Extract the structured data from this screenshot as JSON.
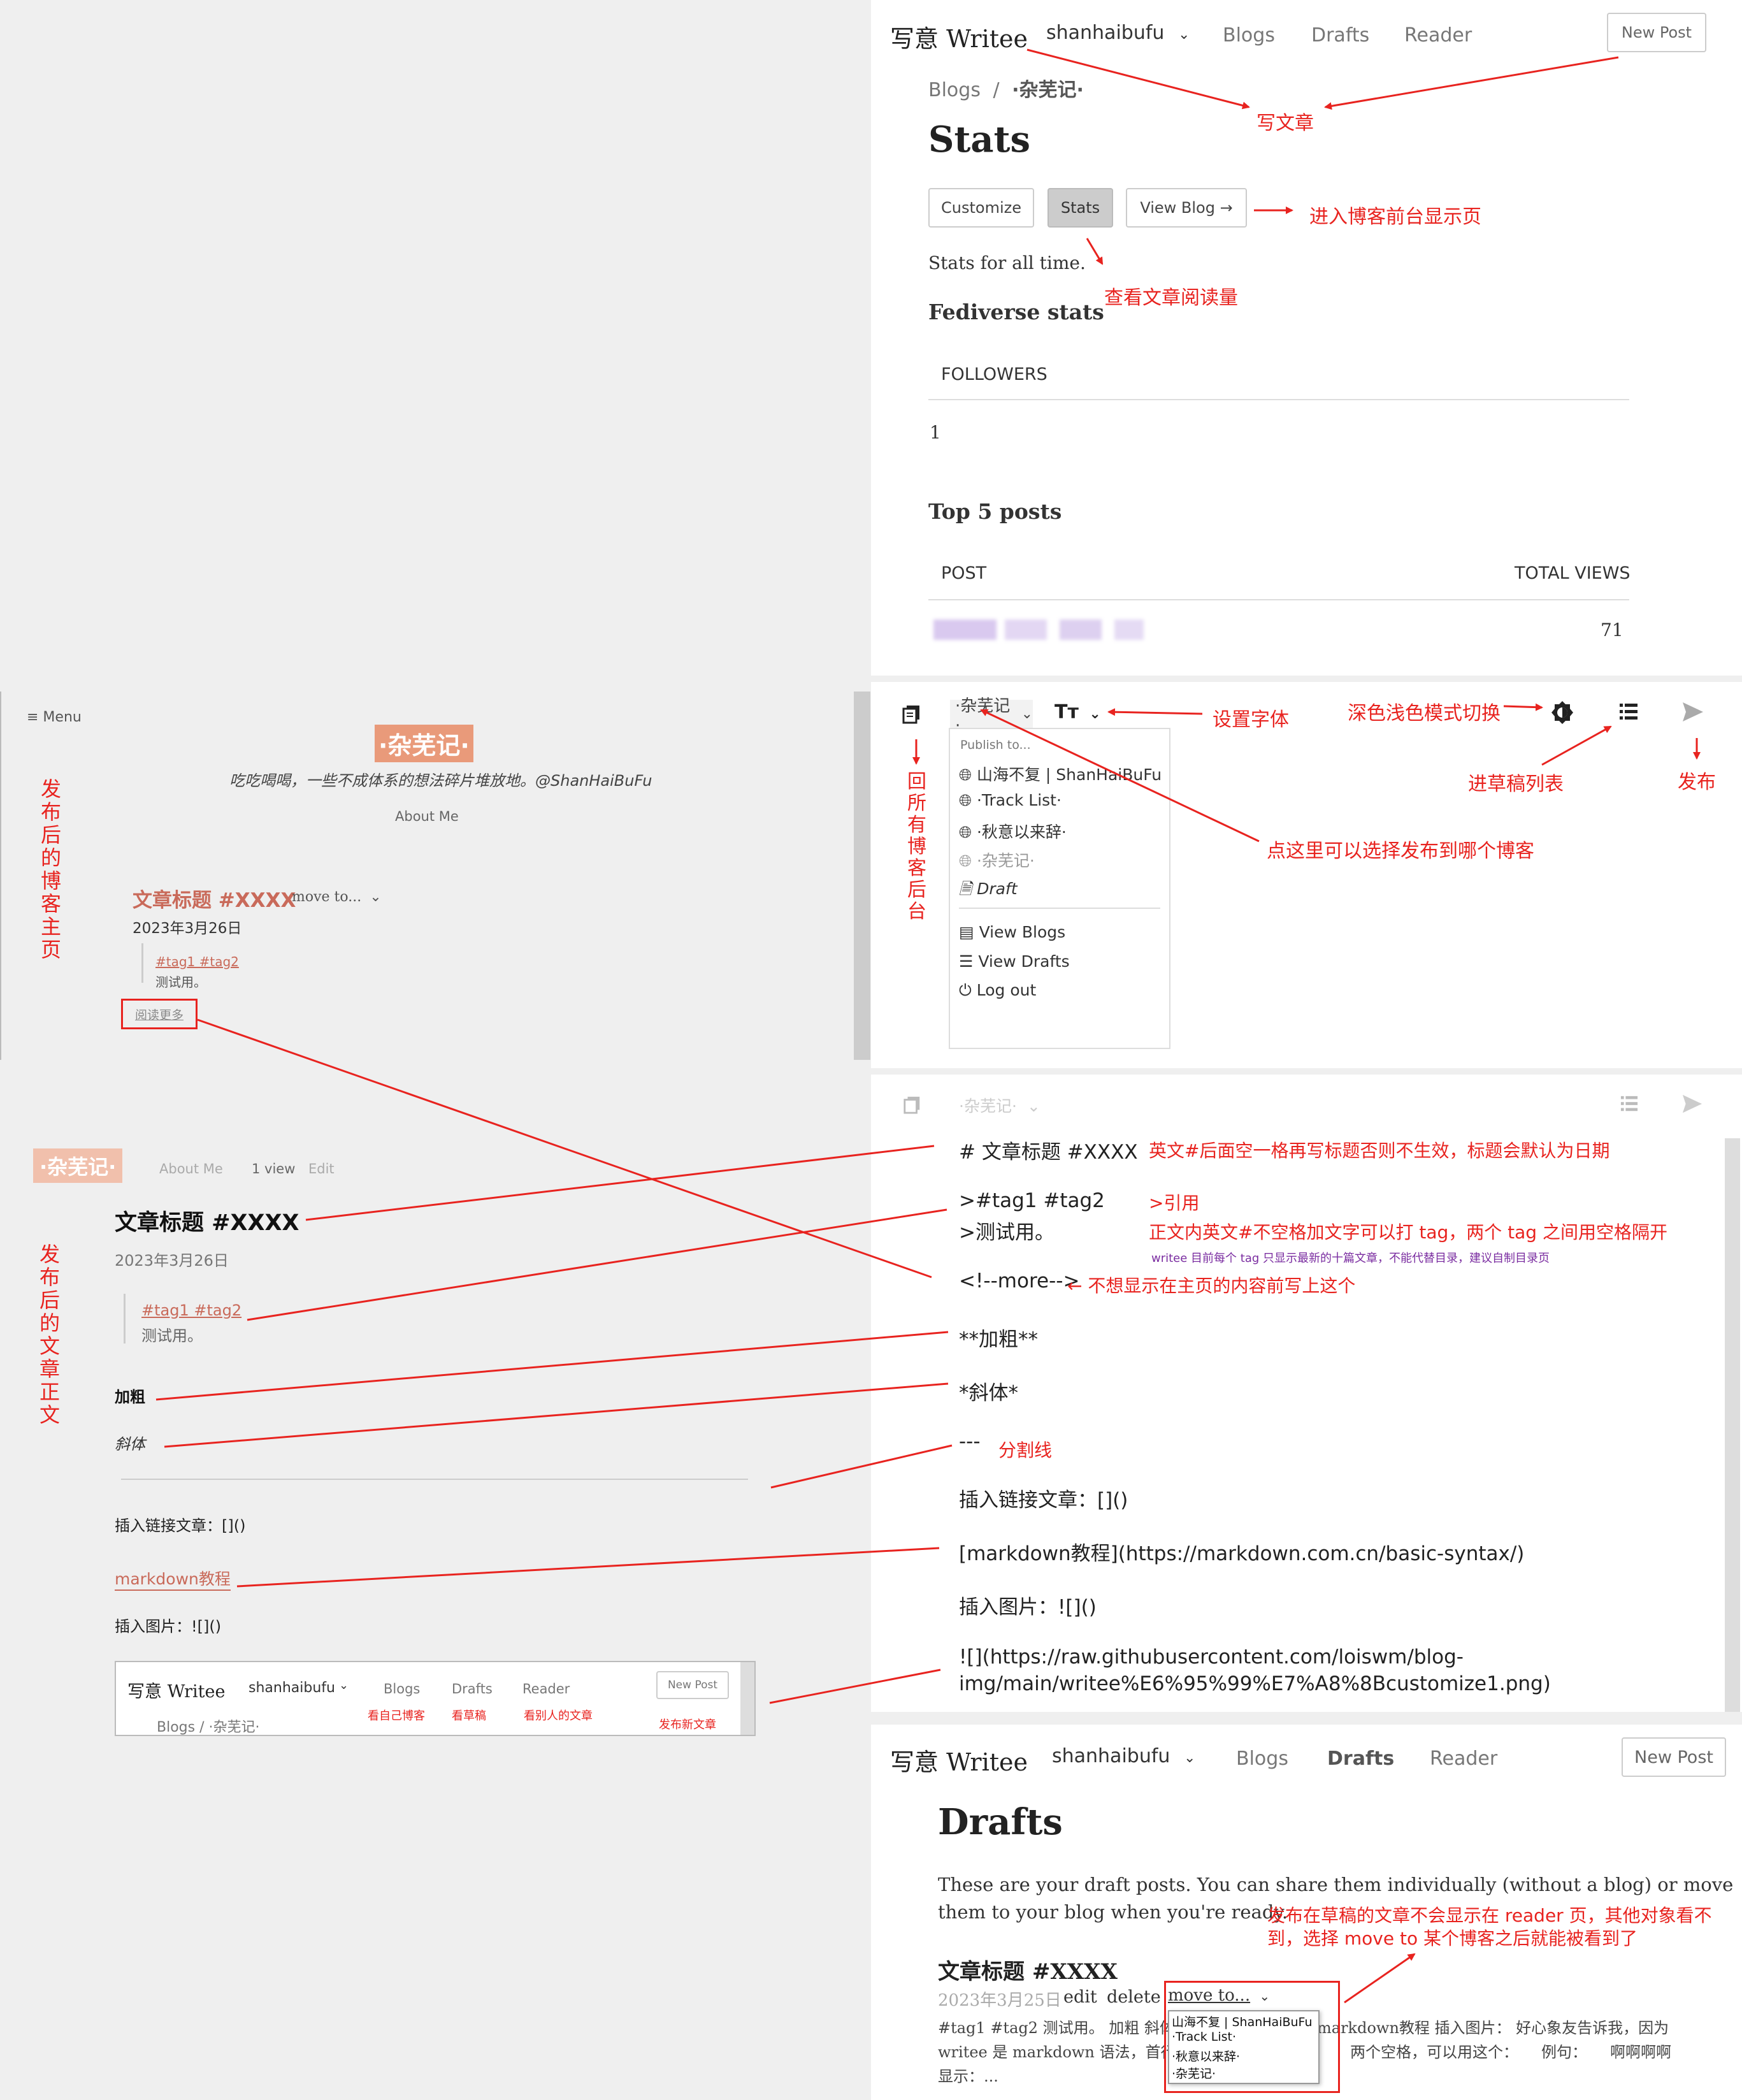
{
  "top_panel": {
    "logo": "写意 Writee",
    "user": "shanhaibufu",
    "nav": [
      "Blogs",
      "Drafts",
      "Reader"
    ],
    "new_post": "New Post",
    "breadcrumb_root": "Blogs",
    "breadcrumb_sep": "/",
    "breadcrumb_current": "·杂芜记·",
    "title": "Stats",
    "buttons": [
      "Customize",
      "Stats",
      "View Blog →"
    ],
    "stats_for": "Stats for all time.",
    "fediverse": "Fediverse stats",
    "followers_header": "FOLLOWERS",
    "followers_value": "1",
    "top5": "Top 5 posts",
    "post_header": "POST",
    "views_header": "TOTAL VIEWS",
    "views_value": "71",
    "notes": {
      "write": "写文章",
      "view_blog": "进入博客前台显示页",
      "stats": "查看文章阅读量"
    }
  },
  "blog_home": {
    "menu": "≡ Menu",
    "blog_name": "·杂芜记·",
    "tagline": "吃吃喝喝，一些不成体系的想法碎片堆放地。@ShanHaiBuFu",
    "about": "About Me",
    "post_title": "文章标题 #XXXX",
    "move_to": "move to...",
    "date": "2023年3月26日",
    "tags": "#tag1 #tag2",
    "excerpt": "测试用。",
    "read_more": "阅读更多",
    "side_label": "发布后的博客主页"
  },
  "editor_menu": {
    "blog_select": "·杂芜记·",
    "font_icon": "Tт",
    "publish_to": "Publish to...",
    "blogs": [
      "山海不复 | ShanHaiBuFu",
      "·Track List·",
      "·秋意以来辞·",
      "·杂芜记·"
    ],
    "draft": "Draft",
    "links": [
      "View Blogs",
      "View Drafts",
      "Log out"
    ],
    "notes": {
      "back": "回所有博客后台",
      "font": "设置字体",
      "mode": "深色浅色模式切换",
      "drafts": "进草稿列表",
      "publish": "发布",
      "choose": "点这里可以选择发布到哪个博客"
    }
  },
  "post_view": {
    "blog_name": "·杂芜记·",
    "about": "About Me",
    "views": "1 view",
    "edit": "Edit",
    "title": "文章标题 #XXXX",
    "date": "2023年3月26日",
    "tags": "#tag1 #tag2",
    "quote": "测试用。",
    "bold": "加粗",
    "italic": "斜体",
    "link_line": "插入链接文章：[]()",
    "link_text": "markdown教程",
    "image_line": "插入图片：![]()",
    "side_label": "发布后的文章正文",
    "embed": {
      "logo": "写意 Writee",
      "user": "shanhaibufu",
      "nav": [
        "Blogs",
        "Drafts",
        "Reader"
      ],
      "new_post": "New Post",
      "breadcrumb": "Blogs / ·杂芜记·",
      "notes": [
        "看自己博客",
        "看草稿",
        "看别人的文章",
        "发布新文章"
      ]
    }
  },
  "editor": {
    "blog_select": "·杂芜记·",
    "lines": [
      "# 文章标题 #XXXX",
      ">#tag1 #tag2",
      ">测试用。",
      "<!--more-->",
      "**加粗**",
      "*斜体*",
      "---",
      "插入链接文章：[]()",
      "[markdown教程](https://markdown.com.cn/basic-syntax/)",
      "插入图片：![]()",
      "![](https://raw.githubusercontent.com/loiswm/blog-",
      "img/main/writee%E6%95%99%E7%A8%8Bcustomize1.png)"
    ],
    "notes": {
      "title": "英文#后面空一格再写标题否则不生效，标题会默认为日期",
      "quote": ">引用",
      "tag": "正文内英文#不空格加文字可以打 tag，两个 tag 之间用空格隔开",
      "tag_small": "writee 目前每个 tag 只显示最新的十篇文章，不能代替目录，建议自制目录页",
      "more": "← 不想显示在主页的内容前写上这个",
      "hr": "分割线"
    }
  },
  "drafts_panel": {
    "logo": "写意 Writee",
    "user": "shanhaibufu",
    "nav": [
      "Blogs",
      "Drafts",
      "Reader"
    ],
    "new_post": "New Post",
    "title": "Drafts",
    "desc1": "These are your draft posts. You can share them individually (without a blog) or move",
    "desc2": "them to your blog when you're ready.",
    "note1": "发布在草稿的文章不会显示在 reader 页，其他对象看不",
    "note2": "到，选择 move to 某个博客之后就能被看到了",
    "post_title": "文章标题 #XXXX",
    "date": "2023年3月25日",
    "edit": "edit",
    "delete": "delete",
    "move_to": "move to...",
    "move_options": [
      "山海不复 | ShanHaiBuFu",
      "·Track List·",
      "·秋意以来辞·",
      "·杂芜记·"
    ],
    "excerpt1a": "#tag1 #tag2 测试用。 加粗 斜体",
    "excerpt1b": "markdown教程 插入图片： 好心象友告诉我，因为",
    "excerpt2a": "writee 是 markdown 语法，首行",
    "excerpt2b": "两个空格，可以用这个：　　例句：　　啊啊啊啊",
    "excerpt3": "显示：..."
  }
}
